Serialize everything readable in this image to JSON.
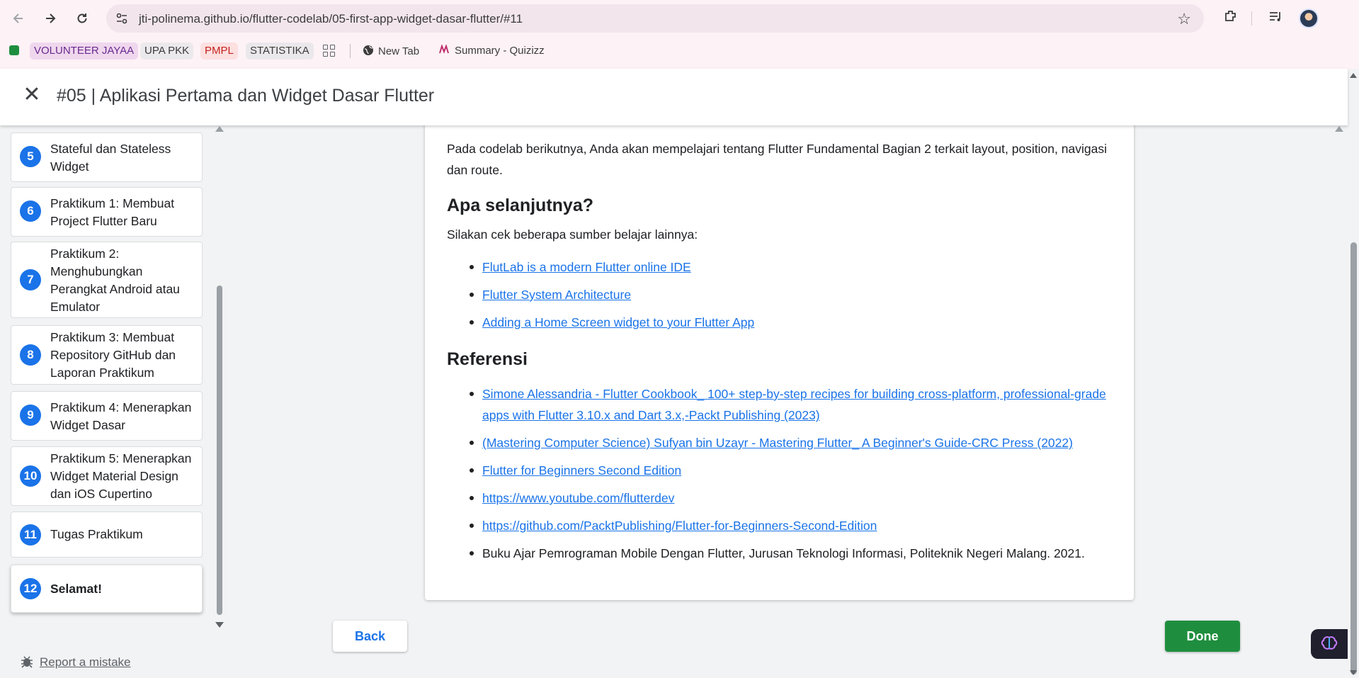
{
  "browser": {
    "url": "jti-polinema.github.io/flutter-codelab/05-first-app-widget-dasar-flutter/#11",
    "bookmarks": [
      {
        "label": "VOLUNTEER JAYAA"
      },
      {
        "label": "UPA PKK"
      },
      {
        "label": "PMPL"
      },
      {
        "label": "STATISTIKA"
      },
      {
        "label": "New Tab"
      },
      {
        "label": "Summary - Quizizz"
      }
    ]
  },
  "header": {
    "title": "#05 | Aplikasi Pertama dan Widget Dasar Flutter"
  },
  "sidebar": {
    "steps": [
      {
        "num": "5",
        "label": "Stateful dan Stateless Widget"
      },
      {
        "num": "6",
        "label": "Praktikum 1: Membuat Project Flutter Baru"
      },
      {
        "num": "7",
        "label": "Praktikum 2: Menghubungkan Perangkat Android atau Emulator"
      },
      {
        "num": "8",
        "label": "Praktikum 3: Membuat Repository GitHub dan Laporan Praktikum"
      },
      {
        "num": "9",
        "label": "Praktikum 4: Menerapkan Widget Dasar"
      },
      {
        "num": "10",
        "label": "Praktikum 5: Menerapkan Widget Material Design dan iOS Cupertino"
      },
      {
        "num": "11",
        "label": "Tugas Praktikum"
      },
      {
        "num": "12",
        "label": "Selamat!"
      }
    ],
    "report_label": "Report a mistake"
  },
  "content": {
    "intro": "Pada codelab berikutnya, Anda akan mempelajari tentang Flutter Fundamental Bagian 2 terkait layout, position, navigasi dan route.",
    "next_heading": "Apa selanjutnya?",
    "next_intro": "Silakan cek beberapa sumber belajar lainnya:",
    "next_links": [
      "FlutLab is a modern Flutter online IDE",
      "Flutter System Architecture",
      "Adding a Home Screen widget to your Flutter App"
    ],
    "ref_heading": "Referensi",
    "ref_links": [
      "Simone Alessandria - Flutter Cookbook_ 100+ step-by-step recipes for building cross-platform, professional-grade apps with Flutter 3.10.x and Dart 3.x,-Packt Publishing (2023)",
      "(Mastering Computer Science) Sufyan bin Uzayr - Mastering Flutter_ A Beginner's Guide-CRC Press (2022)",
      "Flutter for Beginners Second Edition",
      "https://www.youtube.com/flutterdev",
      "https://github.com/PacktPublishing/Flutter-for-Beginners-Second-Edition"
    ],
    "ref_plain": "Buku Ajar Pemrograman Mobile Dengan Flutter, Jurusan Teknologi Informasi, Politeknik Negeri Malang. 2021."
  },
  "footer": {
    "back_label": "Back",
    "done_label": "Done"
  },
  "colors": {
    "accent": "#1a73e8",
    "done": "#1e8e3e"
  }
}
